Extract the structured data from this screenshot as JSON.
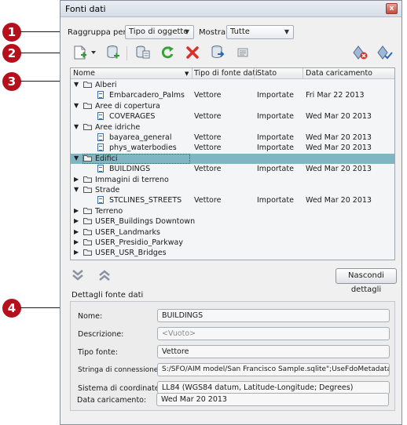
{
  "callouts": [
    "1",
    "2",
    "3",
    "4"
  ],
  "window": {
    "title": "Fonti dati",
    "close_glyph": "x"
  },
  "groupby": {
    "label": "Raggruppa per:",
    "value": "Tipo di oggetto"
  },
  "show": {
    "label": "Mostra:",
    "value": "Tutte"
  },
  "toolbar": {
    "icons": [
      "new-source-icon",
      "add-database-icon",
      "schema-icon",
      "refresh-icon",
      "delete-icon",
      "import-icon",
      "properties-icon",
      "hide-icon",
      "show-icon"
    ]
  },
  "tree": {
    "columns": [
      "Nome",
      "Tipo di fonte dati",
      "Stato",
      "Data caricamento"
    ],
    "rows": [
      {
        "name": "Alberi",
        "kind": "folder",
        "level": 0,
        "expanded": true,
        "type": "",
        "status": "",
        "date": ""
      },
      {
        "name": "Embarcadero_Palms",
        "kind": "item",
        "level": 1,
        "type": "Vettore",
        "status": "Importate",
        "date": "Fri Mar 22 2013"
      },
      {
        "name": "Aree di copertura",
        "kind": "folder",
        "level": 0,
        "expanded": true,
        "type": "",
        "status": "",
        "date": ""
      },
      {
        "name": "COVERAGES",
        "kind": "item",
        "level": 1,
        "type": "Vettore",
        "status": "Importate",
        "date": "Wed Mar 20 2013"
      },
      {
        "name": "Aree idriche",
        "kind": "folder",
        "level": 0,
        "expanded": true,
        "type": "",
        "status": "",
        "date": ""
      },
      {
        "name": "bayarea_general",
        "kind": "item",
        "level": 1,
        "type": "Vettore",
        "status": "Importate",
        "date": "Wed Mar 20 2013"
      },
      {
        "name": "phys_waterbodies",
        "kind": "item",
        "level": 1,
        "type": "Vettore",
        "status": "Importate",
        "date": "Wed Mar 20 2013"
      },
      {
        "name": "Edifici",
        "kind": "folder",
        "level": 0,
        "expanded": true,
        "selected": true,
        "type": "",
        "status": "",
        "date": ""
      },
      {
        "name": "BUILDINGS",
        "kind": "item",
        "level": 1,
        "type": "Vettore",
        "status": "Importate",
        "date": "Wed Mar 20 2013"
      },
      {
        "name": "Immagini di terreno",
        "kind": "folder",
        "level": 0,
        "expanded": false,
        "type": "",
        "status": "",
        "date": ""
      },
      {
        "name": "Strade",
        "kind": "folder",
        "level": 0,
        "expanded": true,
        "type": "",
        "status": "",
        "date": ""
      },
      {
        "name": "STCLINES_STREETS",
        "kind": "item",
        "level": 1,
        "type": "Vettore",
        "status": "Importate",
        "date": "Wed Mar 20 2013"
      },
      {
        "name": "Terreno",
        "kind": "folder",
        "level": 0,
        "expanded": false,
        "type": "",
        "status": "",
        "date": ""
      },
      {
        "name": "USER_Buildings Downtown",
        "kind": "folder",
        "level": 0,
        "expanded": false,
        "type": "",
        "status": "",
        "date": ""
      },
      {
        "name": "USER_Landmarks",
        "kind": "folder",
        "level": 0,
        "expanded": false,
        "type": "",
        "status": "",
        "date": ""
      },
      {
        "name": "USER_Presidio_Parkway",
        "kind": "folder",
        "level": 0,
        "expanded": false,
        "type": "",
        "status": "",
        "date": ""
      },
      {
        "name": "USER_USR_Bridges",
        "kind": "folder",
        "level": 0,
        "expanded": false,
        "type": "",
        "status": "",
        "date": ""
      }
    ]
  },
  "hide_details_button": "Nascondi dettagli",
  "details": {
    "title": "Dettagli fonte dati",
    "fields": [
      {
        "label": "Nome:",
        "value": "BUILDINGS",
        "placeholder": false
      },
      {
        "label": "Descrizione:",
        "value": "<Vuoto>",
        "placeholder": true
      },
      {
        "label": "Tipo fonte:",
        "value": "Vettore",
        "placeholder": false
      },
      {
        "label": "Stringa di connessione:",
        "value": "S:/SFO/AIM model/San Francisco Sample.sqlite\";UseFdoMetadata=TRUE",
        "placeholder": false
      },
      {
        "label": "Sistema di coordinate:",
        "value": "LL84 (WGS84 datum, Latitude-Longitude; Degrees)",
        "placeholder": false
      },
      {
        "label": "Data caricamento:",
        "value": "Wed Mar 20 2013",
        "placeholder": false
      }
    ]
  },
  "colors": {
    "callout": "#b6101d",
    "selection": "#7fb6c2",
    "folder": "#f2f2f2",
    "refresh": "#3aa13a",
    "delete": "#d8302a"
  }
}
